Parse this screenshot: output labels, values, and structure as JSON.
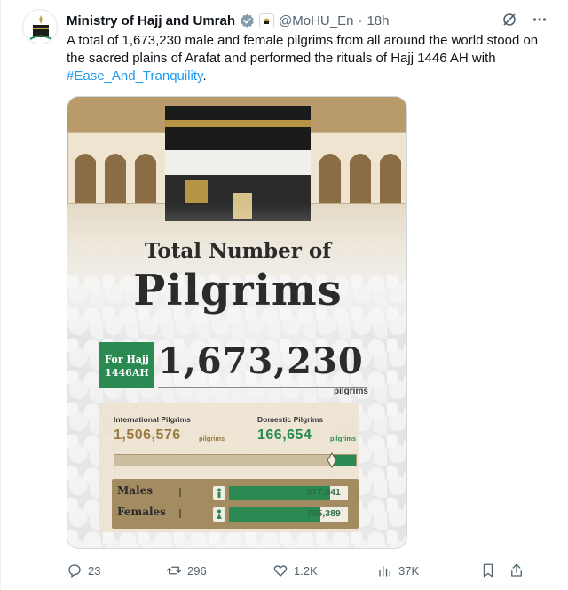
{
  "author": {
    "name": "Ministry of Hajj and Umrah",
    "handle": "@MoHU_En",
    "separator": "·",
    "time": "18h"
  },
  "tweet": {
    "text_before": "A total of 1,673,230 male and female pilgrims from all around the world stood on the sacred plains of Arafat and performed the rituals of Hajj 1446 AH with ",
    "hashtag": "#Ease_And_Tranquility",
    "text_after": "."
  },
  "infographic": {
    "title_line1": "Total Number of",
    "title_line2": "Pilgrims",
    "badge_line1": "For Hajj",
    "badge_line2": "1446AH",
    "total": "1,673,230",
    "total_unit": "pilgrims",
    "international_label": "International Pilgrims",
    "international_value": "1,506,576",
    "international_unit": "pilgrims",
    "domestic_label": "Domestic Pilgrims",
    "domestic_value": "166,654",
    "domestic_unit": "pilgrims",
    "domestic_share": 0.0996,
    "males_label": "Males",
    "males_value": "877,841",
    "males_share": 0.85,
    "females_label": "Females",
    "females_value": "795,389",
    "females_share": 0.77
  },
  "actions": {
    "replies": "23",
    "reposts": "296",
    "likes": "1.2K",
    "views": "37K"
  },
  "colors": {
    "brand_green": "#2a8a52",
    "link_blue": "#1d9bf0",
    "meta_gray": "#536471"
  },
  "icons": [
    "verified-badge-icon",
    "grok-icon",
    "more-icon",
    "reply-icon",
    "repost-icon",
    "like-icon",
    "views-icon",
    "bookmark-icon",
    "share-icon"
  ]
}
